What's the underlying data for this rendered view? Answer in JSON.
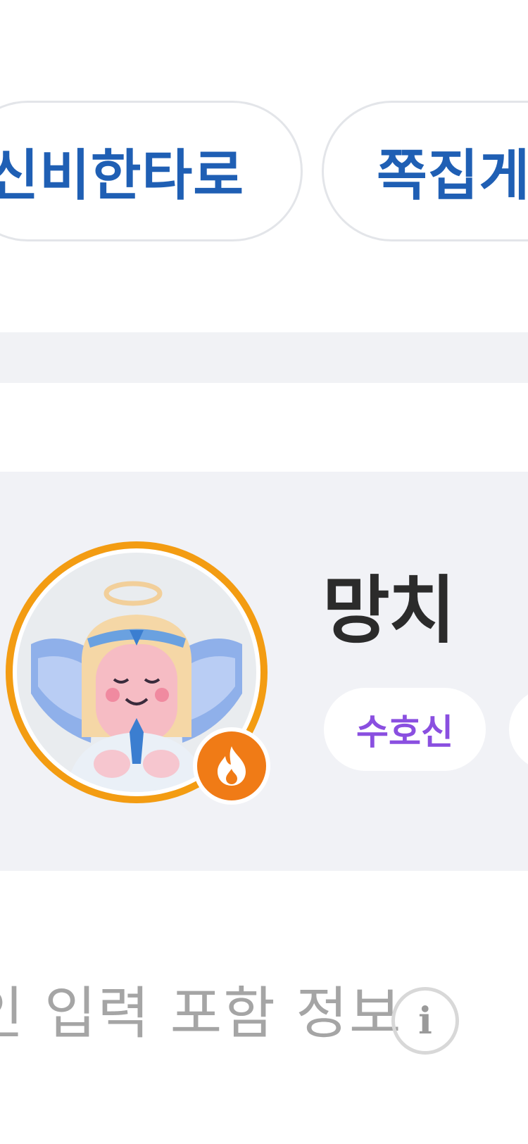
{
  "chips": [
    {
      "label": "신비한타로"
    },
    {
      "label": "쪽집게"
    }
  ],
  "profile": {
    "name": "망치",
    "badge_label": "수호신",
    "avatar_icon": "angel-character-icon",
    "status_icon": "fire-icon"
  },
  "info": {
    "text": "인 입력 포함 정보",
    "icon": "info-icon"
  },
  "colors": {
    "chip_text": "#1f5fb4",
    "badge_text": "#8a4fe0",
    "ring": "#f39c12",
    "fire_badge": "#f07b16",
    "card_bg": "#f1f2f6"
  }
}
